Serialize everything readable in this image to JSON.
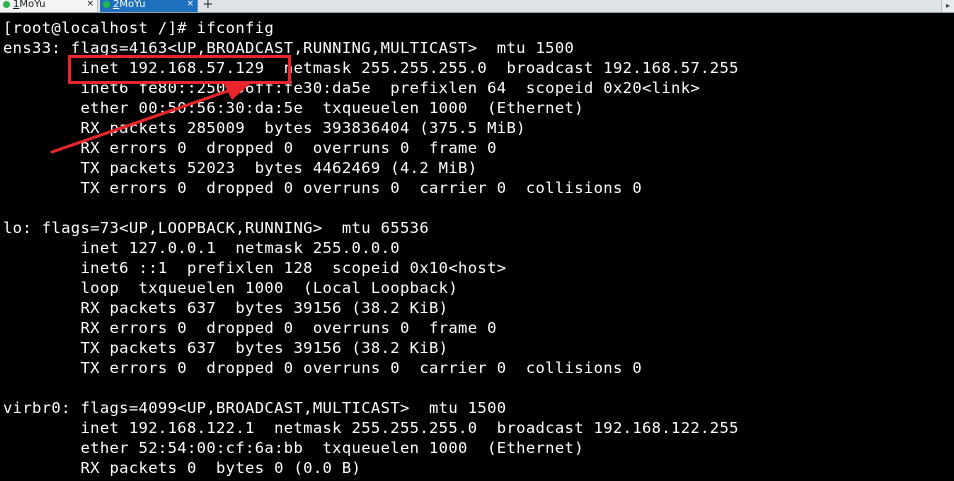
{
  "tabs": [
    {
      "number": "1",
      "label": "MoYu",
      "active": false
    },
    {
      "number": "2",
      "label": "MoYu",
      "active": true
    }
  ],
  "tab_close_glyph": "×",
  "new_tab_glyph": "+",
  "scroll_glyph": "▸",
  "colors": {
    "terminal_bg": "#000000",
    "terminal_fg": "#ffffff",
    "annotation_red": "#e8262b",
    "active_tab": "#1f6fbf",
    "status_dot": "#26b84b"
  },
  "terminal": {
    "lines": [
      "[root@localhost /]# ifconfig",
      "ens33: flags=4163<UP,BROADCAST,RUNNING,MULTICAST>  mtu 1500",
      "        inet 192.168.57.129  netmask 255.255.255.0  broadcast 192.168.57.255",
      "        inet6 fe80::250:56ff:fe30:da5e  prefixlen 64  scopeid 0x20<link>",
      "        ether 00:50:56:30:da:5e  txqueuelen 1000  (Ethernet)",
      "        RX packets 285009  bytes 393836404 (375.5 MiB)",
      "        RX errors 0  dropped 0  overruns 0  frame 0",
      "        TX packets 52023  bytes 4462469 (4.2 MiB)",
      "        TX errors 0  dropped 0 overruns 0  carrier 0  collisions 0",
      "",
      "lo: flags=73<UP,LOOPBACK,RUNNING>  mtu 65536",
      "        inet 127.0.0.1  netmask 255.0.0.0",
      "        inet6 ::1  prefixlen 128  scopeid 0x10<host>",
      "        loop  txqueuelen 1000  (Local Loopback)",
      "        RX packets 637  bytes 39156 (38.2 KiB)",
      "        RX errors 0  dropped 0  overruns 0  frame 0",
      "        TX packets 637  bytes 39156 (38.2 KiB)",
      "        TX errors 0  dropped 0 overruns 0  carrier 0  collisions 0",
      "",
      "virbr0: flags=4099<UP,BROADCAST,MULTICAST>  mtu 1500",
      "        inet 192.168.122.1  netmask 255.255.255.0  broadcast 192.168.122.255",
      "        ether 52:54:00:cf:6a:bb  txqueuelen 1000  (Ethernet)",
      "        RX packets 0  bytes 0 (0.0 B)"
    ]
  }
}
